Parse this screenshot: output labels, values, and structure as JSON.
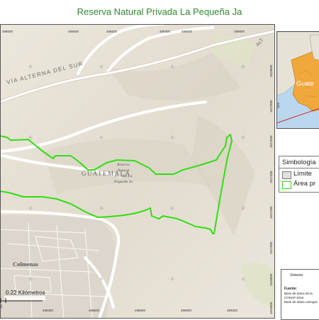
{
  "title": "Reserva Natural Privada La Pequeña Ja",
  "main_map": {
    "grid_labels_top": [
      "498000",
      "499000",
      "499200",
      "499400",
      "498600",
      "499800"
    ],
    "grid_labels_bottom": [
      "498400",
      "498600",
      "498800",
      "499000",
      "499200",
      "499400"
    ],
    "grid_labels_right": [
      "1628000",
      "1627800",
      "1627600",
      "1627400",
      "1627200",
      "1627000",
      "1626800",
      "1626600"
    ],
    "road_label": "Vía Alterna del Sur",
    "road_label_top_right": "Alt",
    "city_label": "Guatemala",
    "neighborhood_label": "Colmenas",
    "reserve_label_lines": [
      "Reserva",
      "Natural",
      "Privada La",
      "Pequeña Ja"
    ],
    "scale_text": "0.22 Kilómetros",
    "scale_zero": "0",
    "colors": {
      "terrain": "#e8e2d8",
      "road": "#ffffff",
      "boundary": "#33dd11",
      "urban": "#dcd6cc",
      "text": "#6b6b6b"
    }
  },
  "inset_map": {
    "country_label": "Guate",
    "coord_label": "920"
  },
  "legend": {
    "title": "Simbología",
    "items": [
      {
        "label": "Límite",
        "swatch_fill": "#e0e0e0",
        "swatch_stroke": "#777777"
      },
      {
        "label": "Área pr",
        "swatch_fill": "#ffffff",
        "swatch_stroke": "#33dd11"
      }
    ]
  },
  "info_box": {
    "heading": "Sistema",
    "source_label": "Fuente:",
    "lines": [
      "Base de datos de la",
      "CONAP 2016",
      "Base de datos cartogra"
    ]
  }
}
